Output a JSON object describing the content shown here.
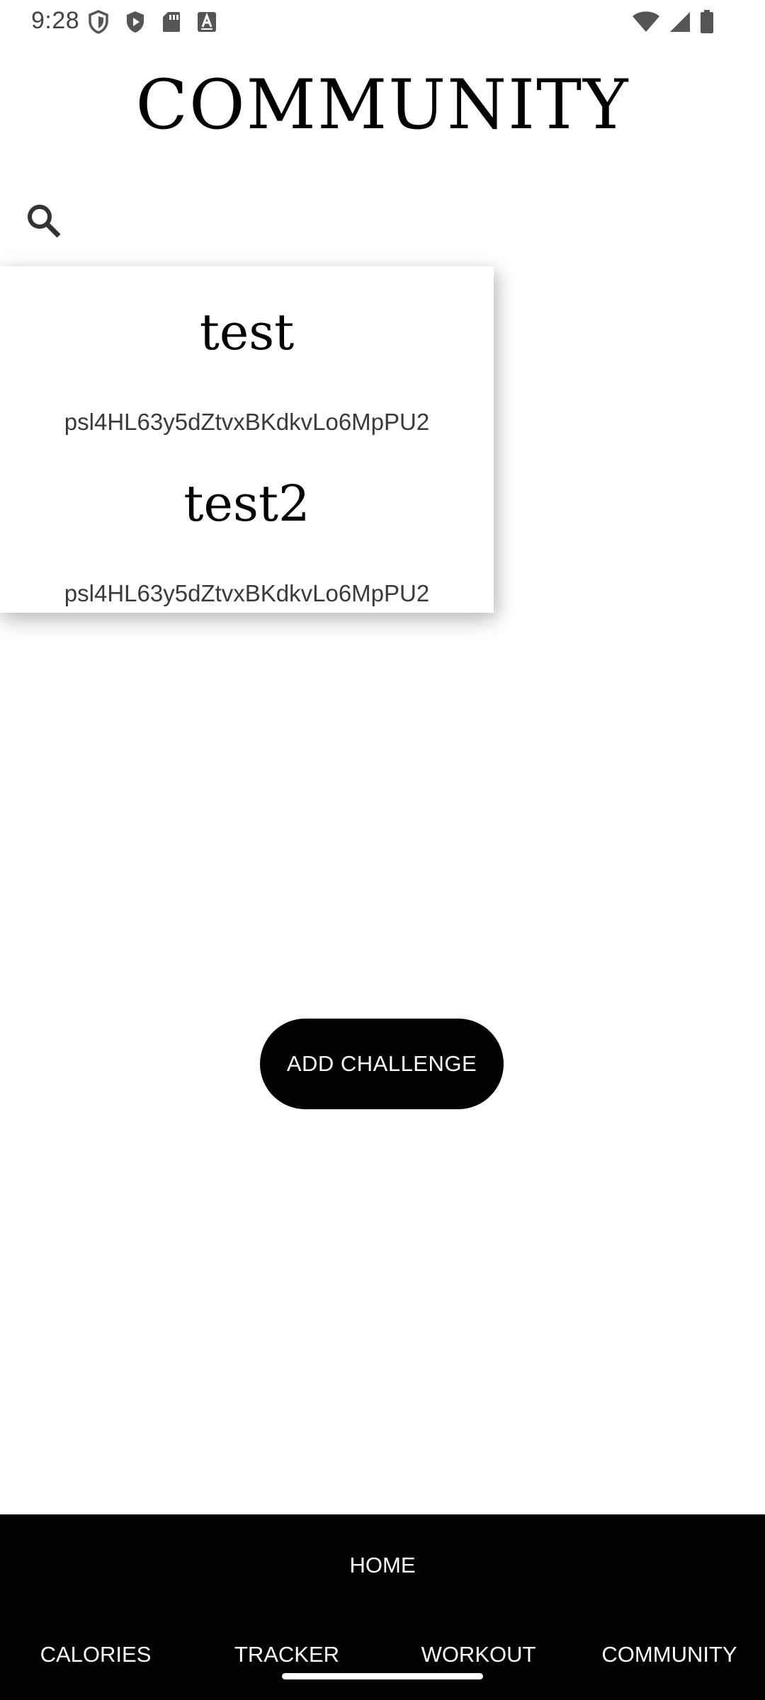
{
  "status_bar": {
    "time": "9:28",
    "left_icons": [
      "shield-outline-icon",
      "shield-play-icon",
      "sd-card-icon",
      "text-a-icon"
    ],
    "right_icons": [
      "wifi-icon",
      "cell-signal-icon",
      "battery-icon"
    ]
  },
  "header": {
    "title": "COMMUNITY"
  },
  "search": {
    "icon": "search-icon"
  },
  "challenges": [
    {
      "name": "test",
      "id": "psl4HL63y5dZtvxBKdkvLo6MpPU2"
    },
    {
      "name": "test2",
      "id": "psl4HL63y5dZtvxBKdkvLo6MpPU2"
    }
  ],
  "add_challenge": {
    "label": "ADD CHALLENGE"
  },
  "bottom_nav": {
    "home": "HOME",
    "items": [
      "CALORIES",
      "TRACKER",
      "WORKOUT",
      "COMMUNITY"
    ]
  },
  "colors": {
    "background": "#ffffff",
    "primary": "#000000",
    "text_on_primary": "#ffffff",
    "secondary_text": "#3a3a3a"
  }
}
